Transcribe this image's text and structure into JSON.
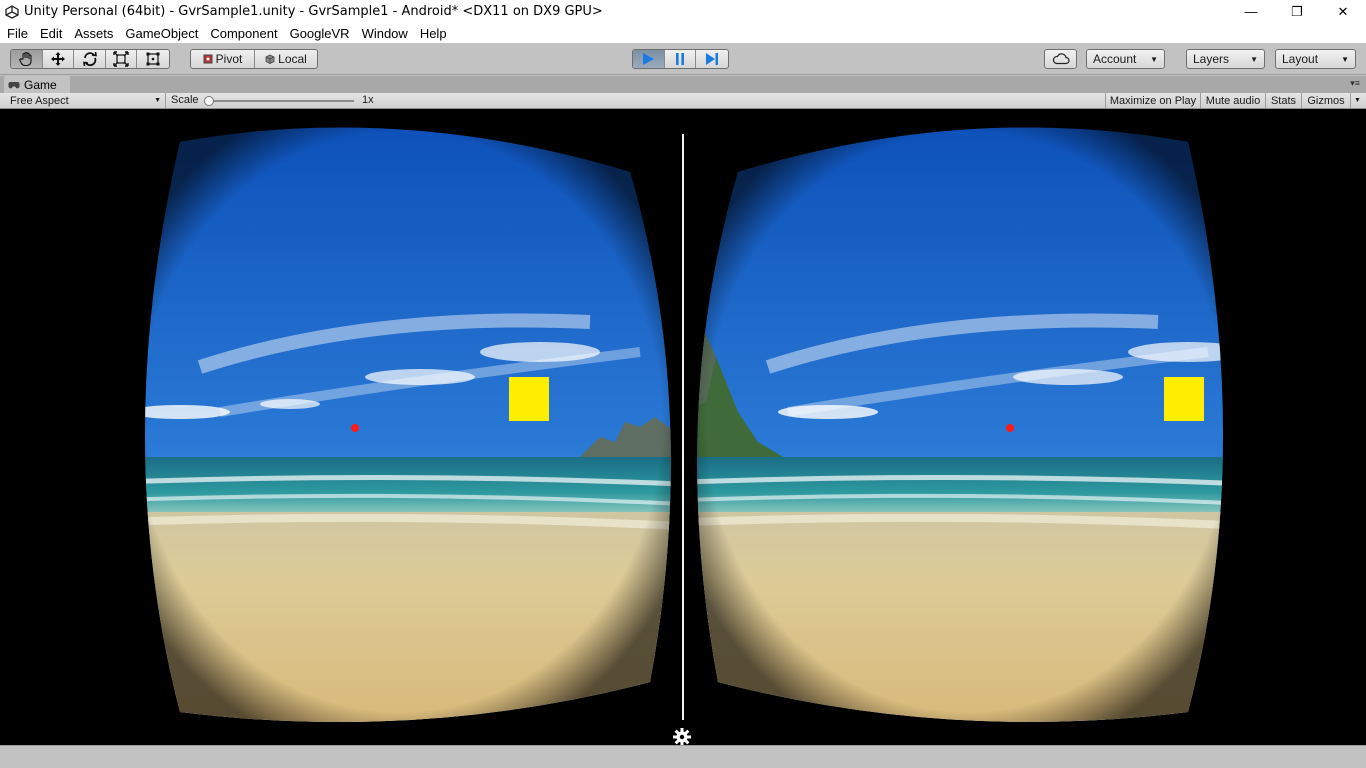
{
  "window": {
    "title": "Unity Personal (64bit) - GvrSample1.unity - GvrSample1 - Android* <DX11 on DX9 GPU>",
    "controls": {
      "minimize": "—",
      "maximize": "❐",
      "close": "✕"
    }
  },
  "menu": [
    "File",
    "Edit",
    "Assets",
    "GameObject",
    "Component",
    "GoogleVR",
    "Window",
    "Help"
  ],
  "toolbar": {
    "transform_tools": [
      "hand-tool",
      "move-tool",
      "rotate-tool",
      "scale-tool",
      "rect-tool"
    ],
    "active_tool": "hand-tool",
    "pivot_label": "Pivot",
    "local_label": "Local",
    "play_state": "playing",
    "account_label": "Account",
    "layers_label": "Layers",
    "layout_label": "Layout"
  },
  "game_tab": {
    "label": "Game"
  },
  "game_toolbar": {
    "aspect": "Free Aspect",
    "scale_label": "Scale",
    "scale_value": "1x",
    "scale_position": 0.0,
    "maximize_label": "Maximize on Play",
    "mute_label": "Mute audio",
    "stats_label": "Stats",
    "gizmos_label": "Gizmos"
  },
  "scene": {
    "sky_color": "#1f6fd0",
    "sea_color": "#1f7f86",
    "sand_color": "#d9c58e",
    "cube_color": "#ffee00",
    "reticle_color": "#ff1a1a",
    "settings_icon": "gear-icon"
  },
  "colors": {
    "editor_bg": "#c2c2c2",
    "play_active": "#1b7be0"
  }
}
